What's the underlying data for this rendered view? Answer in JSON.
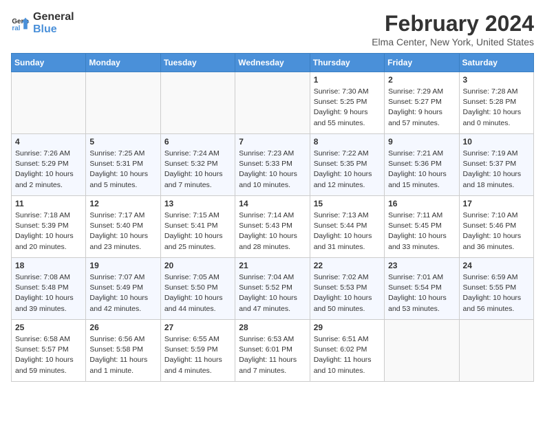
{
  "header": {
    "logo_line1": "General",
    "logo_line2": "Blue",
    "month_year": "February 2024",
    "location": "Elma Center, New York, United States"
  },
  "days_of_week": [
    "Sunday",
    "Monday",
    "Tuesday",
    "Wednesday",
    "Thursday",
    "Friday",
    "Saturday"
  ],
  "weeks": [
    [
      {
        "day": "",
        "info": ""
      },
      {
        "day": "",
        "info": ""
      },
      {
        "day": "",
        "info": ""
      },
      {
        "day": "",
        "info": ""
      },
      {
        "day": "1",
        "info": "Sunrise: 7:30 AM\nSunset: 5:25 PM\nDaylight: 9 hours\nand 55 minutes."
      },
      {
        "day": "2",
        "info": "Sunrise: 7:29 AM\nSunset: 5:27 PM\nDaylight: 9 hours\nand 57 minutes."
      },
      {
        "day": "3",
        "info": "Sunrise: 7:28 AM\nSunset: 5:28 PM\nDaylight: 10 hours\nand 0 minutes."
      }
    ],
    [
      {
        "day": "4",
        "info": "Sunrise: 7:26 AM\nSunset: 5:29 PM\nDaylight: 10 hours\nand 2 minutes."
      },
      {
        "day": "5",
        "info": "Sunrise: 7:25 AM\nSunset: 5:31 PM\nDaylight: 10 hours\nand 5 minutes."
      },
      {
        "day": "6",
        "info": "Sunrise: 7:24 AM\nSunset: 5:32 PM\nDaylight: 10 hours\nand 7 minutes."
      },
      {
        "day": "7",
        "info": "Sunrise: 7:23 AM\nSunset: 5:33 PM\nDaylight: 10 hours\nand 10 minutes."
      },
      {
        "day": "8",
        "info": "Sunrise: 7:22 AM\nSunset: 5:35 PM\nDaylight: 10 hours\nand 12 minutes."
      },
      {
        "day": "9",
        "info": "Sunrise: 7:21 AM\nSunset: 5:36 PM\nDaylight: 10 hours\nand 15 minutes."
      },
      {
        "day": "10",
        "info": "Sunrise: 7:19 AM\nSunset: 5:37 PM\nDaylight: 10 hours\nand 18 minutes."
      }
    ],
    [
      {
        "day": "11",
        "info": "Sunrise: 7:18 AM\nSunset: 5:39 PM\nDaylight: 10 hours\nand 20 minutes."
      },
      {
        "day": "12",
        "info": "Sunrise: 7:17 AM\nSunset: 5:40 PM\nDaylight: 10 hours\nand 23 minutes."
      },
      {
        "day": "13",
        "info": "Sunrise: 7:15 AM\nSunset: 5:41 PM\nDaylight: 10 hours\nand 25 minutes."
      },
      {
        "day": "14",
        "info": "Sunrise: 7:14 AM\nSunset: 5:43 PM\nDaylight: 10 hours\nand 28 minutes."
      },
      {
        "day": "15",
        "info": "Sunrise: 7:13 AM\nSunset: 5:44 PM\nDaylight: 10 hours\nand 31 minutes."
      },
      {
        "day": "16",
        "info": "Sunrise: 7:11 AM\nSunset: 5:45 PM\nDaylight: 10 hours\nand 33 minutes."
      },
      {
        "day": "17",
        "info": "Sunrise: 7:10 AM\nSunset: 5:46 PM\nDaylight: 10 hours\nand 36 minutes."
      }
    ],
    [
      {
        "day": "18",
        "info": "Sunrise: 7:08 AM\nSunset: 5:48 PM\nDaylight: 10 hours\nand 39 minutes."
      },
      {
        "day": "19",
        "info": "Sunrise: 7:07 AM\nSunset: 5:49 PM\nDaylight: 10 hours\nand 42 minutes."
      },
      {
        "day": "20",
        "info": "Sunrise: 7:05 AM\nSunset: 5:50 PM\nDaylight: 10 hours\nand 44 minutes."
      },
      {
        "day": "21",
        "info": "Sunrise: 7:04 AM\nSunset: 5:52 PM\nDaylight: 10 hours\nand 47 minutes."
      },
      {
        "day": "22",
        "info": "Sunrise: 7:02 AM\nSunset: 5:53 PM\nDaylight: 10 hours\nand 50 minutes."
      },
      {
        "day": "23",
        "info": "Sunrise: 7:01 AM\nSunset: 5:54 PM\nDaylight: 10 hours\nand 53 minutes."
      },
      {
        "day": "24",
        "info": "Sunrise: 6:59 AM\nSunset: 5:55 PM\nDaylight: 10 hours\nand 56 minutes."
      }
    ],
    [
      {
        "day": "25",
        "info": "Sunrise: 6:58 AM\nSunset: 5:57 PM\nDaylight: 10 hours\nand 59 minutes."
      },
      {
        "day": "26",
        "info": "Sunrise: 6:56 AM\nSunset: 5:58 PM\nDaylight: 11 hours\nand 1 minute."
      },
      {
        "day": "27",
        "info": "Sunrise: 6:55 AM\nSunset: 5:59 PM\nDaylight: 11 hours\nand 4 minutes."
      },
      {
        "day": "28",
        "info": "Sunrise: 6:53 AM\nSunset: 6:01 PM\nDaylight: 11 hours\nand 7 minutes."
      },
      {
        "day": "29",
        "info": "Sunrise: 6:51 AM\nSunset: 6:02 PM\nDaylight: 11 hours\nand 10 minutes."
      },
      {
        "day": "",
        "info": ""
      },
      {
        "day": "",
        "info": ""
      }
    ]
  ]
}
